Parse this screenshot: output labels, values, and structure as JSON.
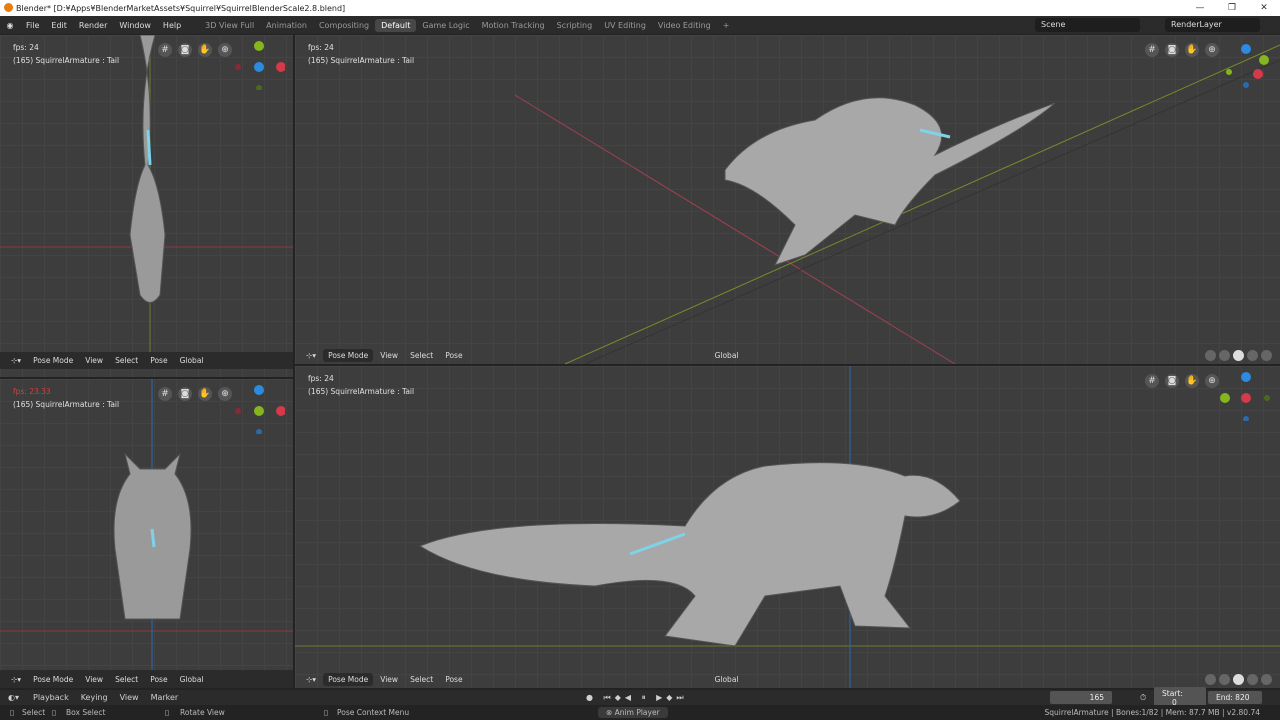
{
  "window": {
    "title": "Blender* [D:¥Apps¥BlenderMarketAssets¥Squirrel¥SquirrelBlenderScale2.8.blend]",
    "controls": [
      "—",
      "❐",
      "✕"
    ]
  },
  "menu": [
    "File",
    "Edit",
    "Render",
    "Window",
    "Help"
  ],
  "workspaces": [
    "3D View Full",
    "Animation",
    "Compositing",
    "Default",
    "Game Logic",
    "Motion Tracking",
    "Scripting",
    "UV Editing",
    "Video Editing",
    "+"
  ],
  "active_workspace": "Default",
  "scene": "Scene",
  "view_layer": "RenderLayer",
  "viewports": [
    {
      "fps": "fps: 24",
      "info": "(165) SquirrelArmature : Tail",
      "mode": "Pose Mode",
      "menus": [
        "View",
        "Select",
        "Pose"
      ],
      "orientation": "Global"
    },
    {
      "fps": "fps: 24",
      "info": "(165) SquirrelArmature : Tail",
      "mode": "Pose Mode",
      "menus": [
        "View",
        "Select",
        "Pose"
      ],
      "orientation": "Global"
    },
    {
      "fps": "fps: 23.33",
      "info": "(165) SquirrelArmature : Tail",
      "mode": "Pose Mode",
      "menus": [
        "View",
        "Select",
        "Pose"
      ],
      "orientation": "Global"
    },
    {
      "fps": "fps: 24",
      "info": "(165) SquirrelArmature : Tail",
      "mode": "Pose Mode",
      "menus": [
        "View",
        "Select",
        "Pose"
      ],
      "orientation": "Global"
    }
  ],
  "gizmo_labels": {
    "x": "X",
    "y": "Y",
    "z": "Z"
  },
  "timeline": {
    "menus": [
      "Playback",
      "Keying",
      "View",
      "Marker"
    ],
    "current_frame": "165",
    "start_label": "Start:",
    "start": "0",
    "end_label": "End:",
    "end": "820"
  },
  "status": {
    "select": "Select",
    "box_select": "Box Select",
    "rotate": "Rotate View",
    "context": "Pose Context Menu",
    "anim_player": "Anim Player",
    "stats": "SquirrelArmature | Bones:1/82  | Mem: 87.7 MB | v2.80.74"
  },
  "colors": {
    "x": "#d6394a",
    "y": "#85b51f",
    "z": "#2c8ae0",
    "bone_select": "#7ed3e8"
  }
}
